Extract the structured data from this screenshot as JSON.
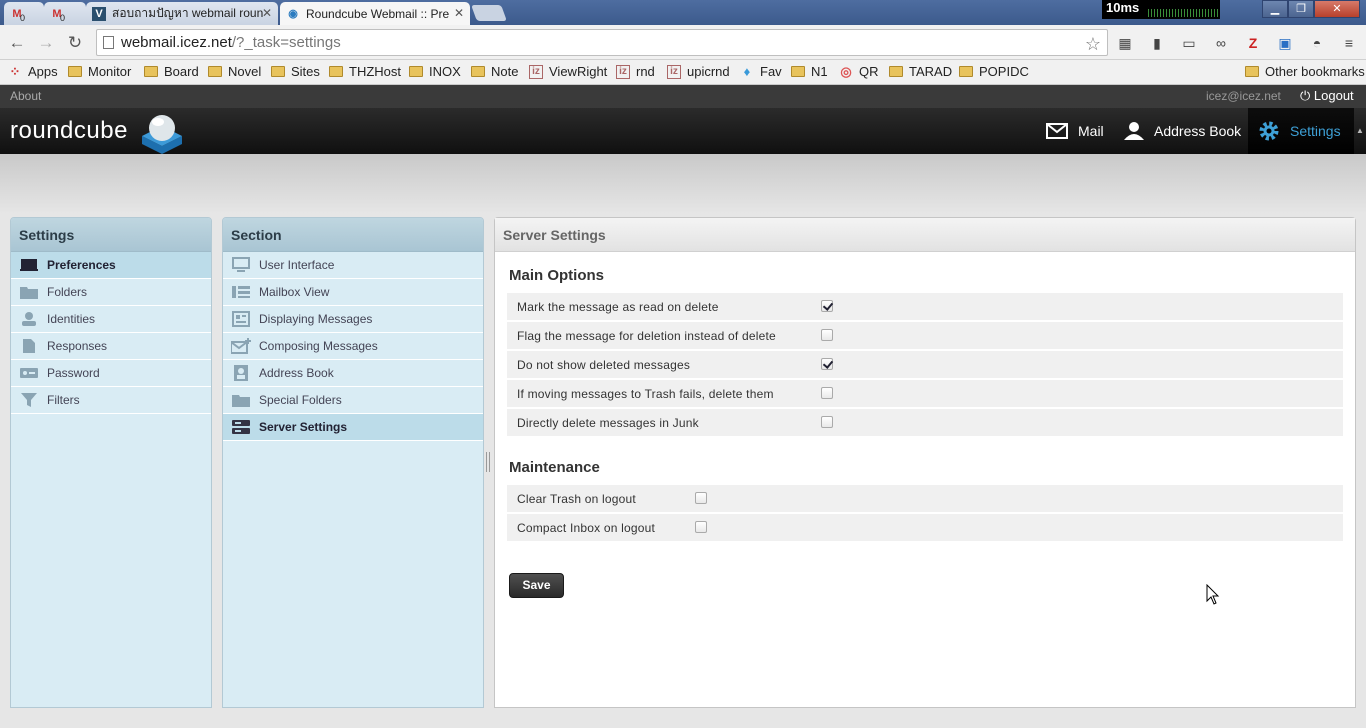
{
  "browser": {
    "tabs": [
      {
        "label": "",
        "icon": "gmail-icon",
        "badge": "0"
      },
      {
        "label": "",
        "icon": "gmail-icon",
        "badge": "0"
      },
      {
        "label": "สอบถามปัญหา webmail roun",
        "icon": "forum-icon"
      },
      {
        "label": "Roundcube Webmail :: Pre",
        "icon": "roundcube-icon",
        "active": true
      }
    ],
    "ping": "10ms",
    "url_host": "webmail.icez.net",
    "url_path": "/?_task=settings",
    "bookmarks": [
      {
        "label": "Apps",
        "type": "apps"
      },
      {
        "label": "Monitor",
        "type": "folder"
      },
      {
        "label": "Board",
        "type": "folder"
      },
      {
        "label": "Novel",
        "type": "folder"
      },
      {
        "label": "Sites",
        "type": "folder"
      },
      {
        "label": "THZHost",
        "type": "folder"
      },
      {
        "label": "INOX",
        "type": "folder"
      },
      {
        "label": "Note",
        "type": "folder"
      },
      {
        "label": "ViewRight",
        "type": "site"
      },
      {
        "label": "rnd",
        "type": "site"
      },
      {
        "label": "upicrnd",
        "type": "site"
      },
      {
        "label": "Fav",
        "type": "twitter"
      },
      {
        "label": "N1",
        "type": "folder"
      },
      {
        "label": "QR",
        "type": "site"
      },
      {
        "label": "TARAD",
        "type": "folder"
      },
      {
        "label": "POPIDC",
        "type": "folder"
      }
    ],
    "other_bookmarks": "Other bookmarks"
  },
  "app": {
    "about": "About",
    "user_email": "icez@icez.net",
    "logout": "Logout",
    "logo": "roundcube",
    "nav": {
      "mail": "Mail",
      "addressbook": "Address Book",
      "settings": "Settings"
    },
    "accent": "#3ea0d6"
  },
  "settings_panel": {
    "title": "Settings",
    "items": [
      {
        "label": "Preferences",
        "icon": "monitor-icon",
        "selected": true
      },
      {
        "label": "Folders",
        "icon": "folder-icon"
      },
      {
        "label": "Identities",
        "icon": "person-icon"
      },
      {
        "label": "Responses",
        "icon": "document-icon"
      },
      {
        "label": "Password",
        "icon": "password-icon"
      },
      {
        "label": "Filters",
        "icon": "filter-icon"
      }
    ]
  },
  "section_panel": {
    "title": "Section",
    "items": [
      {
        "label": "User Interface",
        "icon": "monitor-icon"
      },
      {
        "label": "Mailbox View",
        "icon": "list-icon"
      },
      {
        "label": "Displaying Messages",
        "icon": "message-icon"
      },
      {
        "label": "Composing Messages",
        "icon": "compose-icon"
      },
      {
        "label": "Address Book",
        "icon": "addressbook-icon"
      },
      {
        "label": "Special Folders",
        "icon": "folder-icon"
      },
      {
        "label": "Server Settings",
        "icon": "server-icon",
        "selected": true
      }
    ]
  },
  "content": {
    "title": "Server Settings",
    "main_options": {
      "title": "Main Options",
      "options": [
        {
          "label": "Mark the message as read on delete",
          "checked": true
        },
        {
          "label": "Flag the message for deletion instead of delete",
          "checked": false
        },
        {
          "label": "Do not show deleted messages",
          "checked": true
        },
        {
          "label": "If moving messages to Trash fails, delete them",
          "checked": false
        },
        {
          "label": "Directly delete messages in Junk",
          "checked": false
        }
      ]
    },
    "maintenance": {
      "title": "Maintenance",
      "options": [
        {
          "label": "Clear Trash on logout",
          "checked": false
        },
        {
          "label": "Compact Inbox on logout",
          "checked": false
        }
      ]
    },
    "save_label": "Save"
  }
}
